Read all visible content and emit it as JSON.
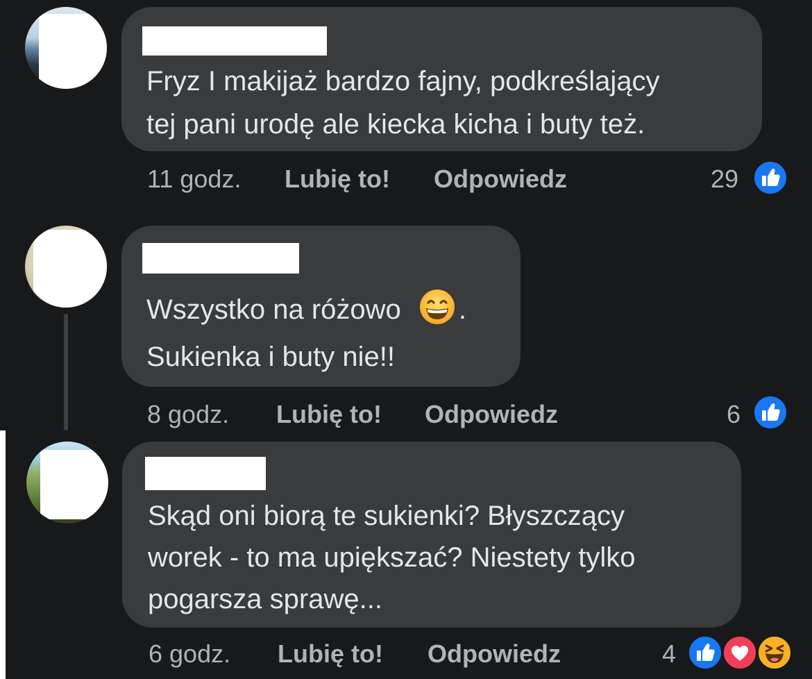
{
  "colors": {
    "background": "#18191a",
    "bubble": "#3a3b3c",
    "text": "#e4e6eb",
    "meta": "#b0b3b8",
    "like_blue": "#1877f2",
    "love_red": "#f33e58",
    "haha_yellow": "#f7b125"
  },
  "comments": [
    {
      "lines": [
        "Fryz I makijaż bardzo fajny, podkreślający",
        "tej pani urodę ale kiecka kicha i buty też."
      ],
      "time": "11 godz.",
      "like_label": "Lubię to!",
      "reply_label": "Odpowiedz",
      "reaction_count": "29",
      "reactions": [
        "like-icon"
      ]
    },
    {
      "lines": [
        "Wszystko na różowo",
        "Sukienka i buty nie!!"
      ],
      "line1_suffix": ".",
      "inline_emoji": "grinning-face-icon",
      "time": "8 godz.",
      "like_label": "Lubię to!",
      "reply_label": "Odpowiedz",
      "reaction_count": "6",
      "reactions": [
        "like-icon"
      ]
    },
    {
      "lines": [
        "Skąd oni biorą te sukienki? Błyszczący",
        "worek - to ma upiększać? Niestety tylko",
        "pogarsza sprawę..."
      ],
      "time": "6 godz.",
      "like_label": "Lubię to!",
      "reply_label": "Odpowiedz",
      "reaction_count": "4",
      "reactions": [
        "like-icon",
        "love-icon",
        "haha-icon"
      ]
    }
  ]
}
